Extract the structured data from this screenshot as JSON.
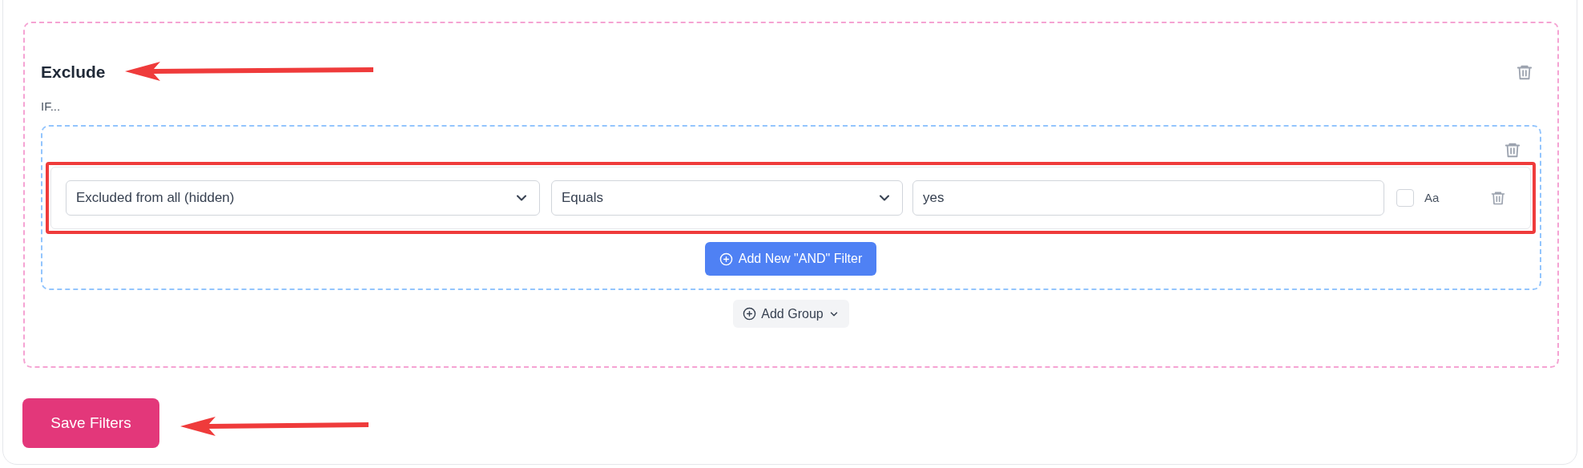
{
  "section": {
    "title": "Exclude",
    "condition_label": "IF...",
    "group": {
      "filters": [
        {
          "field": "Excluded from all (hidden)",
          "operator": "Equals",
          "value": "yes",
          "case_sensitive": {
            "label": "Aa",
            "checked": false
          }
        }
      ],
      "add_filter_button": "Add New \"AND\" Filter"
    },
    "add_group_button": "Add Group"
  },
  "save_button": "Save Filters"
}
